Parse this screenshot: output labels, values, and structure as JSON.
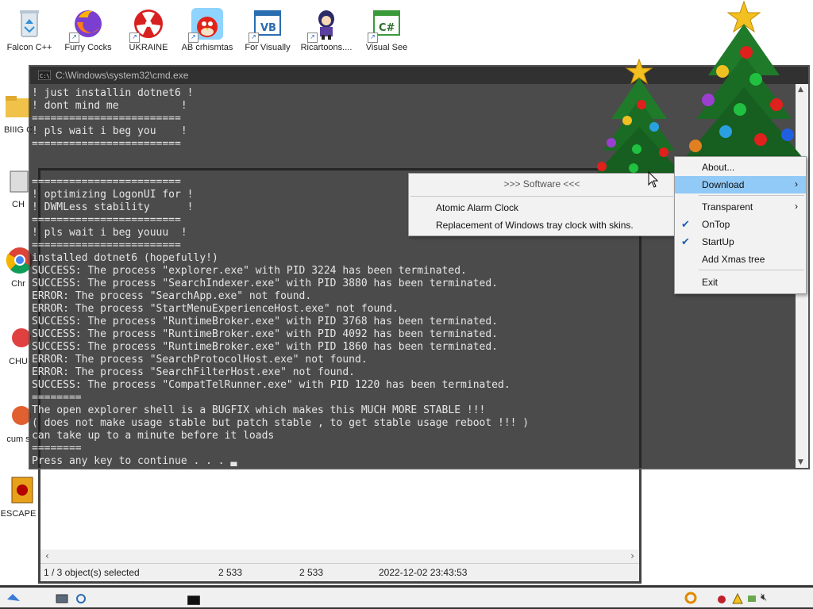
{
  "desktop_icons": [
    {
      "label": "Falcon C++",
      "icon": "recycle-bin-icon"
    },
    {
      "label": "Furry Cocks",
      "icon": "firefox-icon"
    },
    {
      "label": "UKRAINE",
      "icon": "radiation-icon"
    },
    {
      "label": "AB crhismtas",
      "icon": "angry-bird-icon"
    },
    {
      "label": "For Visually",
      "icon": "vb-icon"
    },
    {
      "label": "Ricartoons....",
      "icon": "cartoon-icon"
    },
    {
      "label": "Visual See",
      "icon": "csharp-icon"
    }
  ],
  "left_icons": [
    {
      "label": "BIIIG C",
      "icon": "folder-icon"
    },
    {
      "label": "CH",
      "icon": "app-icon"
    },
    {
      "label": "Chr",
      "icon": "chrome-icon"
    },
    {
      "label": "CHU",
      "icon": "app-icon"
    },
    {
      "label": "cum s",
      "icon": "app-icon"
    },
    {
      "label": "ESCAPE",
      "icon": "mahjong-icon"
    }
  ],
  "cmd": {
    "title": "C:\\Windows\\system32\\cmd.exe",
    "lines": [
      "! just installin dotnet6 !",
      "! dont mind me          !",
      "========================",
      "! pls wait i beg you    !",
      "========================",
      "",
      "",
      "========================",
      "! optimizing LogonUI for !",
      "! DWMLess stability      !",
      "========================",
      "! pls wait i beg youuu  !",
      "========================",
      "installed dotnet6 (hopefully!)",
      "SUCCESS: The process \"explorer.exe\" with PID 3224 has been terminated.",
      "SUCCESS: The process \"SearchIndexer.exe\" with PID 3880 has been terminated.",
      "ERROR: The process \"SearchApp.exe\" not found.",
      "ERROR: The process \"StartMenuExperienceHost.exe\" not found.",
      "SUCCESS: The process \"RuntimeBroker.exe\" with PID 3768 has been terminated.",
      "SUCCESS: The process \"RuntimeBroker.exe\" with PID 4092 has been terminated.",
      "SUCCESS: The process \"RuntimeBroker.exe\" with PID 1860 has been terminated.",
      "ERROR: The process \"SearchProtocolHost.exe\" not found.",
      "ERROR: The process \"SearchFilterHost.exe\" not found.",
      "SUCCESS: The process \"CompatTelRunner.exe\" with PID 1220 has been terminated.",
      "========",
      "The open explorer shell is a BUGFIX which makes this MUCH MORE STABLE !!!",
      "( does not make usage stable but patch stable , to get stable usage reboot !!! )",
      "can take up to a minute before it loads",
      "========",
      "Press any key to continue . . . "
    ]
  },
  "file_manager": {
    "status": {
      "selected": "1 / 3 object(s) selected",
      "size1": "2 533",
      "size2": "2 533",
      "date": "2022-12-02 23:43:53"
    }
  },
  "submenu": {
    "header": ">>> Software <<<",
    "items": [
      {
        "label": "Atomic Alarm Clock"
      },
      {
        "label": "Replacement of Windows tray clock with skins."
      }
    ]
  },
  "context_menu": {
    "items": [
      {
        "label": "About...",
        "checked": false,
        "submenu": false
      },
      {
        "label": "Download",
        "checked": false,
        "submenu": true,
        "selected": true
      },
      {
        "label": "Transparent",
        "checked": false,
        "submenu": true
      },
      {
        "label": "OnTop",
        "checked": true,
        "submenu": false
      },
      {
        "label": "StartUp",
        "checked": true,
        "submenu": false
      },
      {
        "label": "Add Xmas tree",
        "checked": false,
        "submenu": false
      },
      {
        "label": "Exit",
        "checked": false,
        "submenu": false
      }
    ]
  },
  "colors": {
    "menu_highlight": "#91c9f7",
    "cmd_bg": "#1e1e1e"
  }
}
